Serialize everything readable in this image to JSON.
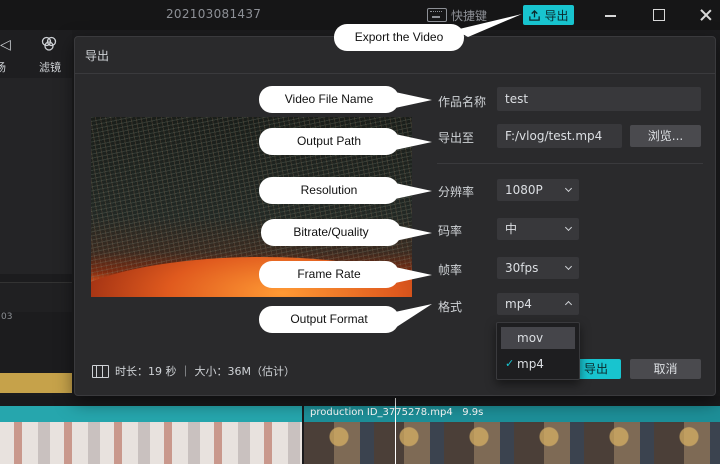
{
  "window": {
    "title": "202103081437",
    "shortcut_label": "快捷键",
    "export_label": "导出"
  },
  "toolbar": {
    "partial_label": "场",
    "filter_label": "滤镜"
  },
  "timeline": {
    "ruler_label": "03",
    "clip_name": "production ID_3775278.mp4",
    "clip_duration": "9.9s"
  },
  "dialog": {
    "title": "导出",
    "fields": {
      "name_label": "作品名称",
      "name_value": "test",
      "path_label": "导出至",
      "path_value": "F:/vlog/test.mp4",
      "browse_label": "浏览...",
      "resolution_label": "分辨率",
      "resolution_value": "1080P",
      "bitrate_label": "码率",
      "bitrate_value": "中",
      "framerate_label": "帧率",
      "framerate_value": "30fps",
      "format_label": "格式",
      "format_value": "mp4"
    },
    "format_options": [
      "mov",
      "mp4"
    ],
    "footer_info": "时长：19 秒 ｜ 大小：36M（估计）",
    "confirm_label": "导出",
    "cancel_label": "取消"
  },
  "callouts": {
    "export": "Export the Video",
    "file_name": "Video File Name",
    "output_path": "Output Path",
    "resolution": "Resolution",
    "bitrate": "Bitrate/Quality",
    "frame_rate": "Frame Rate",
    "output_format": "Output Format"
  },
  "colors": {
    "accent": "#18c4cf",
    "dialog_bg": "#2a2a2c",
    "callout_bg": "#ffffff"
  }
}
